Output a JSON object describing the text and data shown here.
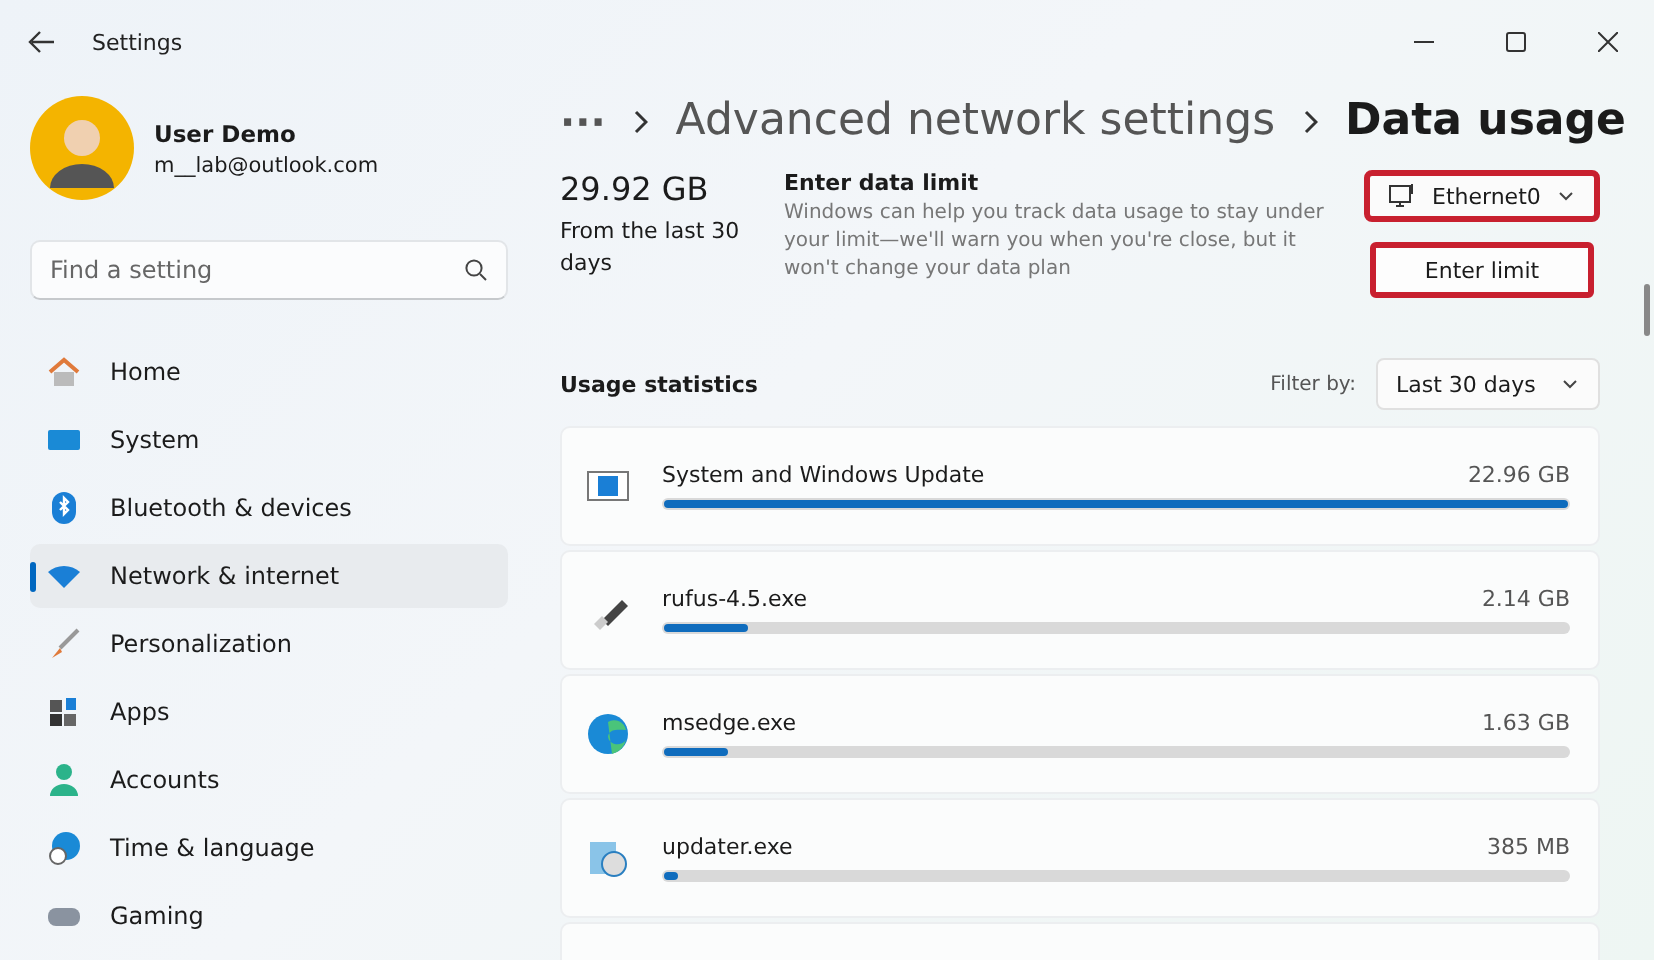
{
  "window": {
    "title": "Settings"
  },
  "user": {
    "name": "User Demo",
    "email": "m__lab@outlook.com"
  },
  "search": {
    "placeholder": "Find a setting"
  },
  "sidebar": {
    "items": [
      {
        "label": "Home",
        "selected": false
      },
      {
        "label": "System",
        "selected": false
      },
      {
        "label": "Bluetooth & devices",
        "selected": false
      },
      {
        "label": "Network & internet",
        "selected": true
      },
      {
        "label": "Personalization",
        "selected": false
      },
      {
        "label": "Apps",
        "selected": false
      },
      {
        "label": "Accounts",
        "selected": false
      },
      {
        "label": "Time & language",
        "selected": false
      },
      {
        "label": "Gaming",
        "selected": false
      }
    ]
  },
  "breadcrumb": {
    "ellipsis": "···",
    "parent": "Advanced network settings",
    "current": "Data usage"
  },
  "summary": {
    "total": "29.92 GB",
    "period": "From the last 30 days"
  },
  "data_limit": {
    "title": "Enter data limit",
    "description": "Windows can help you track data usage to stay under your limit—we'll warn you when you're close, but it won't change your data plan",
    "adapter": {
      "value": "Ethernet0",
      "highlighted": true
    },
    "button": {
      "label": "Enter limit",
      "highlighted": true
    }
  },
  "usage": {
    "title": "Usage statistics",
    "filter_label": "Filter by:",
    "filter_value": "Last 30 days",
    "apps": [
      {
        "name": "System and Windows Update",
        "amount": "22.96 GB",
        "level": 1.0
      },
      {
        "name": "rufus-4.5.exe",
        "amount": "2.14 GB",
        "level": 0.094
      },
      {
        "name": "msedge.exe",
        "amount": "1.63 GB",
        "level": 0.07
      },
      {
        "name": "updater.exe",
        "amount": "385 MB",
        "level": 0.015
      }
    ]
  }
}
